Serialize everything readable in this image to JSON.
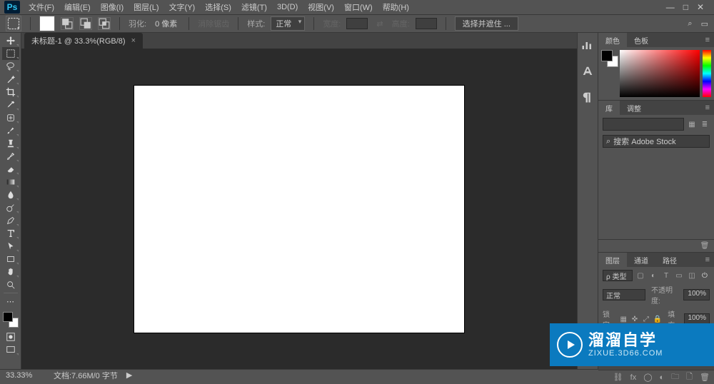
{
  "menubar": {
    "logo": "Ps",
    "items": [
      "文件(F)",
      "编辑(E)",
      "图像(I)",
      "图层(L)",
      "文字(Y)",
      "选择(S)",
      "滤镜(T)",
      "3D(D)",
      "视图(V)",
      "窗口(W)",
      "帮助(H)"
    ]
  },
  "window_controls": {
    "min": "—",
    "max": "□",
    "close": "✕"
  },
  "options": {
    "feather_label": "羽化:",
    "feather_value": "0 像素",
    "antialias": "消除锯齿",
    "style_label": "样式:",
    "style_value": "正常",
    "width_label": "宽度:",
    "height_label": "高度:",
    "select_mask_btn": "选择并遮住 ..."
  },
  "doc_tab": {
    "title": "未标题-1 @ 33.3%(RGB/8)",
    "close": "×"
  },
  "midstrip_icons": [
    "histogram-icon",
    "character-icon",
    "paragraph-icon"
  ],
  "panels": {
    "color_tabs": [
      "颜色",
      "色板"
    ],
    "lib_tabs": [
      "库",
      "调整"
    ],
    "lib_search_ph": "搜索 Adobe Stock",
    "layer_tabs": [
      "图层",
      "通道",
      "路径"
    ],
    "layer_filter": "ρ 类型",
    "blend_mode": "正常",
    "opacity_label": "不透明度:",
    "opacity_value": "100%",
    "lock_label": "锁定:",
    "fill_label": "填充:",
    "fill_value": "100%"
  },
  "status": {
    "zoom": "33.33%",
    "doc": "文档:7.66M/0 字节",
    "arrow": "▶"
  },
  "watermark": {
    "cn": "溜溜自学",
    "url": "ZIXUE.3D66.COM"
  },
  "tools": [
    "move-tool",
    "marquee-tool",
    "lasso-tool",
    "magic-wand-tool",
    "crop-tool",
    "eyedropper-tool",
    "healing-brush-tool",
    "brush-tool",
    "clone-stamp-tool",
    "history-brush-tool",
    "eraser-tool",
    "gradient-tool",
    "blur-tool",
    "dodge-tool",
    "pen-tool",
    "type-tool",
    "path-select-tool",
    "rectangle-tool",
    "hand-tool",
    "zoom-tool",
    "edit-toolbar"
  ]
}
